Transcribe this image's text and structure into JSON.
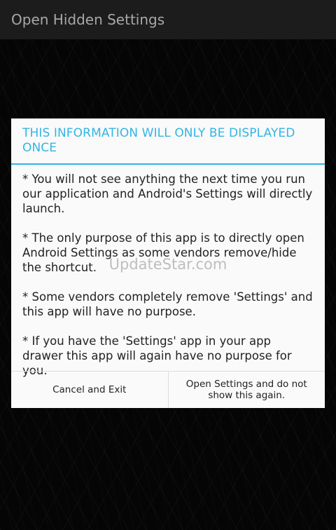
{
  "action_bar": {
    "title": "Open Hidden Settings"
  },
  "dialog": {
    "title": "THIS INFORMATION WILL ONLY BE DISPLAYED ONCE",
    "paragraphs": [
      "* You will not see anything the next time you run our application and Android's Settings will directly launch.",
      "* The only purpose of this app is to directly open Android Settings as some vendors remove/hide the shortcut.",
      "* Some vendors completely remove 'Settings' and this app will have no purpose.",
      "* If you have the 'Settings' app in your app drawer this app will again have no purpose for you."
    ],
    "buttons": {
      "negative": "Cancel and Exit",
      "positive": "Open Settings and do not show this again."
    }
  },
  "watermark": "UpdateStar.com",
  "colors": {
    "accent": "#33b5e5",
    "action_bar_bg": "#1c1c1c",
    "dialog_bg": "#fafafa"
  }
}
